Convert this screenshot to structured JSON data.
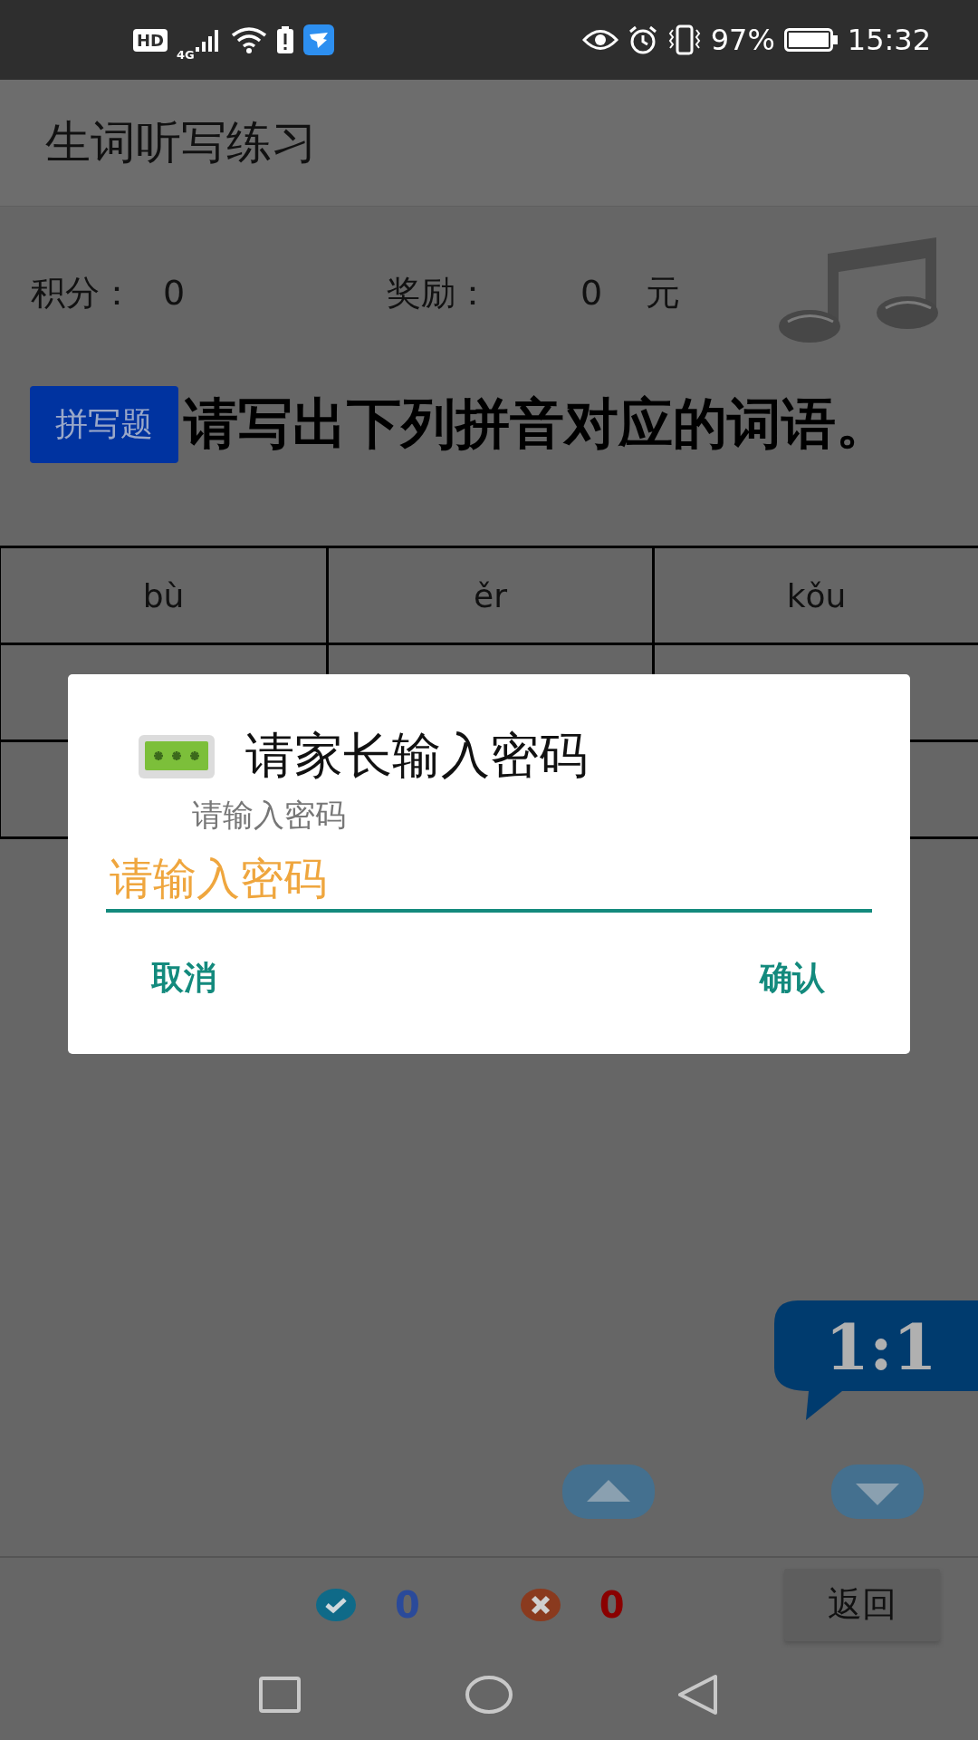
{
  "status_bar": {
    "hd": "HD",
    "network": "4G",
    "battery": "97%",
    "time": "15:32"
  },
  "app_bar": {
    "title": "生词听写练习"
  },
  "scores": [
    {
      "label": "积分：",
      "value": "0"
    },
    {
      "label": "奖励：",
      "value": "0",
      "unit": "元"
    }
  ],
  "question": {
    "badge": "拼写题",
    "prompt": "请写出下列拼音对应的词语。"
  },
  "table": {
    "rows": [
      {
        "cells": [
          "bù",
          "ěr",
          "kǒu"
        ]
      },
      {
        "blank": true
      },
      {
        "blank": true
      }
    ]
  },
  "dialog": {
    "title": "请家长输入密码",
    "message": "请输入密码",
    "input": {
      "placeholder": "请输入密码"
    },
    "buttons": [
      "取消",
      "确认"
    ]
  },
  "ratio_bubble": "1:1",
  "tally": [
    {
      "kind": "correct",
      "count": "0"
    },
    {
      "kind": "wrong",
      "count": "0"
    }
  ],
  "back_button": "返回"
}
